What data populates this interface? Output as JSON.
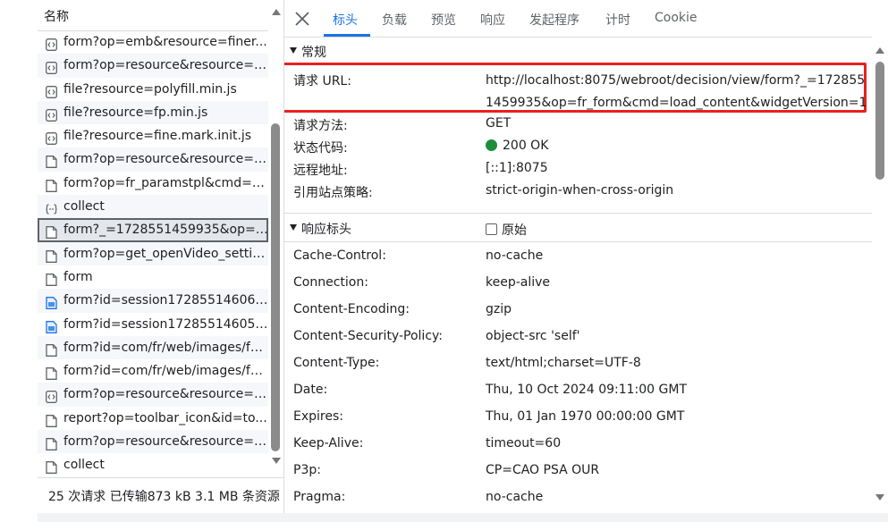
{
  "list": {
    "column_header": "名称",
    "rows": [
      {
        "name": "form?op=emb&resource=finer...",
        "icon": "script-icon"
      },
      {
        "name": "form?op=resource&resource=/...",
        "icon": "script-icon"
      },
      {
        "name": "file?resource=polyfill.min.js",
        "icon": "script-icon"
      },
      {
        "name": "file?resource=fp.min.js",
        "icon": "script-icon"
      },
      {
        "name": "file?resource=fine.mark.init.js",
        "icon": "script-icon"
      },
      {
        "name": "form?op=resource&resource=/...",
        "icon": "document-icon"
      },
      {
        "name": "form?op=fr_paramstpl&cmd=q...",
        "icon": "document-icon"
      },
      {
        "name": "collect",
        "icon": "fetch-icon"
      },
      {
        "name": "form?_=1728551459935&op=fr...",
        "icon": "document-icon"
      },
      {
        "name": "form?op=get_openVideo_settin...",
        "icon": "document-icon"
      },
      {
        "name": "form",
        "icon": "document-icon"
      },
      {
        "name": "form?id=session172855146062...",
        "icon": "image-icon"
      },
      {
        "name": "form?id=session172855146058...",
        "icon": "image-icon"
      },
      {
        "name": "form?id=com/fr/web/images/fo...",
        "icon": "document-icon"
      },
      {
        "name": "form?id=com/fr/web/images/fo...",
        "icon": "document-icon"
      },
      {
        "name": "form?op=resource&resource=/...",
        "icon": "script-icon"
      },
      {
        "name": "report?op=toolbar_icon&id=to...",
        "icon": "document-icon"
      },
      {
        "name": "form?op=resource&resource=/...",
        "icon": "document-icon"
      },
      {
        "name": "collect",
        "icon": "document-icon"
      }
    ],
    "selected_index": 8,
    "status": "25 次请求  已传输873 kB  3.1 MB 条资源"
  },
  "tabs": [
    "标头",
    "负载",
    "预览",
    "响应",
    "发起程序",
    "计时",
    "Cookie"
  ],
  "active_tab": 0,
  "general": {
    "title": "常规",
    "request_url_label": "请求 URL:",
    "request_url": "http://localhost:8075/webroot/decision/view/form?_=1728551459935&op=fr_form&cmd=load_content&widgetVersion=1",
    "method_label": "请求方法:",
    "method": "GET",
    "status_label": "状态代码:",
    "status": "200 OK",
    "remote_label": "远程地址:",
    "remote": "[::1]:8075",
    "referrer_label": "引用站点策略:",
    "referrer": "strict-origin-when-cross-origin"
  },
  "response_headers": {
    "title": "响应标头",
    "raw_label": "原始",
    "items": [
      {
        "key": "Cache-Control:",
        "value": "no-cache"
      },
      {
        "key": "Connection:",
        "value": "keep-alive"
      },
      {
        "key": "Content-Encoding:",
        "value": "gzip"
      },
      {
        "key": "Content-Security-Policy:",
        "value": "object-src 'self'"
      },
      {
        "key": "Content-Type:",
        "value": "text/html;charset=UTF-8"
      },
      {
        "key": "Date:",
        "value": "Thu, 10 Oct 2024 09:11:00 GMT"
      },
      {
        "key": "Expires:",
        "value": "Thu, 01 Jan 1970 00:00:00 GMT"
      },
      {
        "key": "Keep-Alive:",
        "value": "timeout=60"
      },
      {
        "key": "P3p:",
        "value": "CP=CAO PSA OUR"
      },
      {
        "key": "Pragma:",
        "value": "no-cache"
      }
    ]
  },
  "colors": {
    "accent": "#1a73e8",
    "highlight_box": "#e8201e",
    "status_ok": "#1e8e3e"
  }
}
